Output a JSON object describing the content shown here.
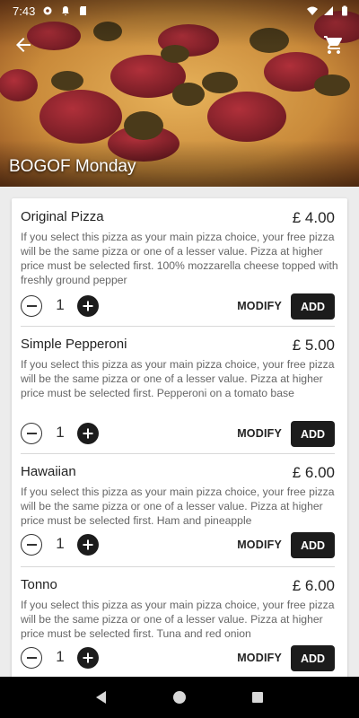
{
  "status_bar": {
    "time": "7:43",
    "left_icons": [
      "gear-icon",
      "bell-icon",
      "sd-card-icon"
    ],
    "right_icons": [
      "wifi-icon",
      "signal-icon",
      "battery-icon"
    ]
  },
  "header": {
    "title": "BOGOF Monday",
    "back_icon": "arrow-back-icon",
    "cart_icon": "cart-icon"
  },
  "items": [
    {
      "name": "Original Pizza",
      "price": "£ 4.00",
      "description": "If you select this pizza as your main pizza choice, your free pizza will be the same pizza or one of a lesser value. Pizza at higher price must be selected first. 100% mozzarella cheese topped with freshly ground pepper",
      "quantity": "1",
      "modify_label": "MODIFY",
      "add_label": "ADD"
    },
    {
      "name": "Simple Pepperoni",
      "price": "£ 5.00",
      "description": "If you select this pizza as your main pizza choice, your free pizza will be the same pizza or one of a lesser value. Pizza at higher price must be selected first. Pepperoni on a tomato base",
      "quantity": "1",
      "modify_label": "MODIFY",
      "add_label": "ADD"
    },
    {
      "name": "Hawaiian",
      "price": "£ 6.00",
      "description": "If you select this pizza as your main pizza choice, your free pizza will be the same pizza or one of a lesser value. Pizza at higher price must be selected first. Ham and pineapple",
      "quantity": "1",
      "modify_label": "MODIFY",
      "add_label": "ADD"
    },
    {
      "name": "Tonno",
      "price": "£ 6.00",
      "description": "If you select this pizza as your main pizza choice, your free pizza will be the same pizza or one of a lesser value. Pizza at higher price must be selected first. Tuna and red onion",
      "quantity": "1",
      "modify_label": "MODIFY",
      "add_label": "ADD"
    }
  ],
  "nav_bar": {
    "buttons": [
      "back-triangle-icon",
      "home-circle-icon",
      "recents-square-icon"
    ]
  },
  "colors": {
    "accent": "#1c1c1c",
    "background": "#ececec",
    "card": "#ffffff"
  }
}
